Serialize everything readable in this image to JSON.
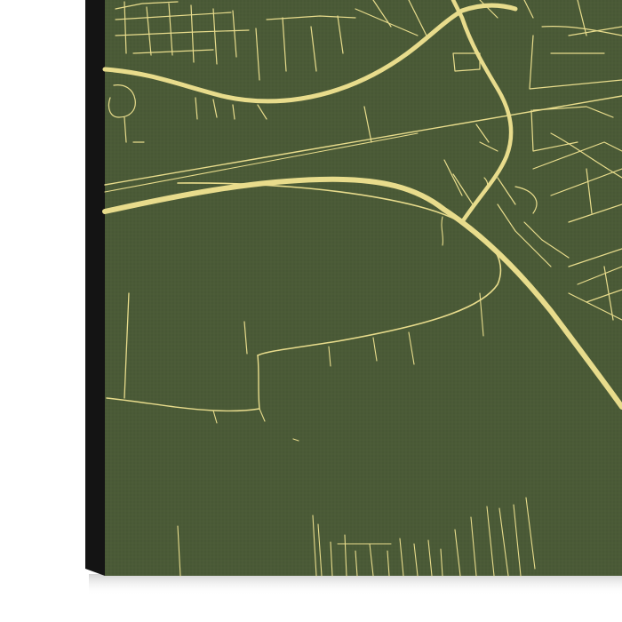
{
  "product": {
    "type": "canvas-map-print",
    "style": "minimal street map",
    "labels_visible": false
  },
  "colors": {
    "background": "#ffffff",
    "canvas": "#4a5a36",
    "canvas_edge": "#141414",
    "roads": "#e8dc8c",
    "shadow": "#d9d9d9"
  },
  "map": {
    "features": [
      "river-or-main-road",
      "railway-line",
      "highway",
      "ring-road",
      "residential-grid",
      "farm-tracks"
    ]
  }
}
